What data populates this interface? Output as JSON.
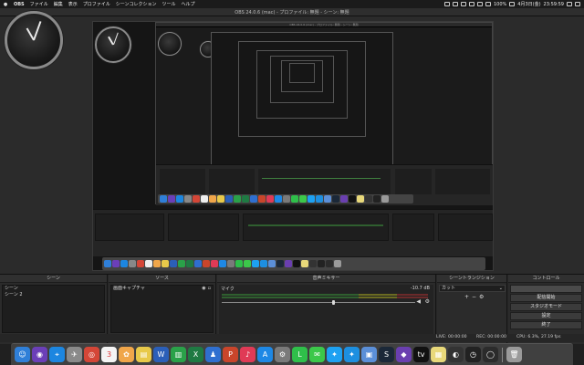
{
  "menubar": {
    "apple": "",
    "items": [
      "OBS",
      "ファイル",
      "編集",
      "表示",
      "プロファイル",
      "シーンコレクション",
      "ツール",
      "ヘルプ"
    ],
    "battery": "100%",
    "date": "4月3日(金)",
    "time": "23:59:59"
  },
  "window": {
    "title": "OBS 24.0.6 (mac) - プロファイル: 無題 - シーン: 無題"
  },
  "docks": {
    "scenes": {
      "title": "シーン",
      "items": [
        "シーン",
        "シーン 2"
      ],
      "toolbar": {
        "add": "+",
        "remove": "−",
        "up": "∧",
        "down": "∨"
      }
    },
    "sources": {
      "title": "ソース",
      "items": [
        "画面キャプチャ"
      ],
      "toolbar": {
        "add": "+",
        "remove": "−",
        "settings": "⚙",
        "up": "∧",
        "down": "∨"
      }
    },
    "mixer": {
      "title": "音声ミキサー",
      "tracks": [
        {
          "name": "マイク",
          "db": "-10.7 dB",
          "volume": 0.58
        }
      ]
    },
    "transitions": {
      "title": "シーントランジション",
      "selected": "カット",
      "add": "+",
      "remove": "−"
    },
    "controls": {
      "title": "コントロール",
      "buttons": [
        "",
        "配信開始",
        "スタジオモード",
        "設定",
        "終了"
      ]
    }
  },
  "status": {
    "live": "LIVE: 00:00:00",
    "rec": "REC: 00:00:00",
    "cpu": "CPU: 6.3%, 27.19 fps"
  },
  "nested_title": "OBS 24.0.6 (mac) - プロファイル: 無題 - シーン: 無題",
  "dock_apps": [
    {
      "name": "finder",
      "color": "#2f7fd8",
      "glyph": "☺"
    },
    {
      "name": "siri",
      "color": "#6b3fb8",
      "glyph": "◉"
    },
    {
      "name": "safari",
      "color": "#1c86e0",
      "glyph": "⌖"
    },
    {
      "name": "launchpad",
      "color": "#8a8a8a",
      "glyph": "✈"
    },
    {
      "name": "chrome",
      "color": "#d44637",
      "glyph": "◎"
    },
    {
      "name": "calendar",
      "color": "#f4f4f4",
      "glyph": "3"
    },
    {
      "name": "photos",
      "color": "#f0a64a",
      "glyph": "✿"
    },
    {
      "name": "notes",
      "color": "#e8c94a",
      "glyph": "▤"
    },
    {
      "name": "word",
      "color": "#2b5fb8",
      "glyph": "W"
    },
    {
      "name": "numbers",
      "color": "#2aa149",
      "glyph": "▥"
    },
    {
      "name": "excel",
      "color": "#1f7a43",
      "glyph": "X"
    },
    {
      "name": "keynote",
      "color": "#2f6fd0",
      "glyph": "♟"
    },
    {
      "name": "powerpoint",
      "color": "#c9452b",
      "glyph": "P"
    },
    {
      "name": "music",
      "color": "#e03a56",
      "glyph": "♪"
    },
    {
      "name": "appstore",
      "color": "#1e88e5",
      "glyph": "A"
    },
    {
      "name": "preferences",
      "color": "#7a7a7a",
      "glyph": "⚙"
    },
    {
      "name": "line",
      "color": "#2fbf4a",
      "glyph": "L"
    },
    {
      "name": "messages",
      "color": "#3cc84a",
      "glyph": "✉"
    },
    {
      "name": "twitter",
      "color": "#1da1f2",
      "glyph": "✦"
    },
    {
      "name": "twitter2",
      "color": "#1d8fe0",
      "glyph": "✦"
    },
    {
      "name": "preview",
      "color": "#5b8fd8",
      "glyph": "▣"
    },
    {
      "name": "steam",
      "color": "#1b2838",
      "glyph": "S"
    },
    {
      "name": "vpn",
      "color": "#6a3fb0",
      "glyph": "◆"
    },
    {
      "name": "tv",
      "color": "#111111",
      "glyph": "tv"
    },
    {
      "name": "notes2",
      "color": "#e8d87a",
      "glyph": "▦"
    },
    {
      "name": "photobooth",
      "color": "#333333",
      "glyph": "◐"
    },
    {
      "name": "clock",
      "color": "#222222",
      "glyph": "◷"
    },
    {
      "name": "obs",
      "color": "#2b2b2b",
      "glyph": "◯"
    },
    {
      "name": "trash",
      "color": "#9a9a9a",
      "glyph": "🗑"
    }
  ]
}
